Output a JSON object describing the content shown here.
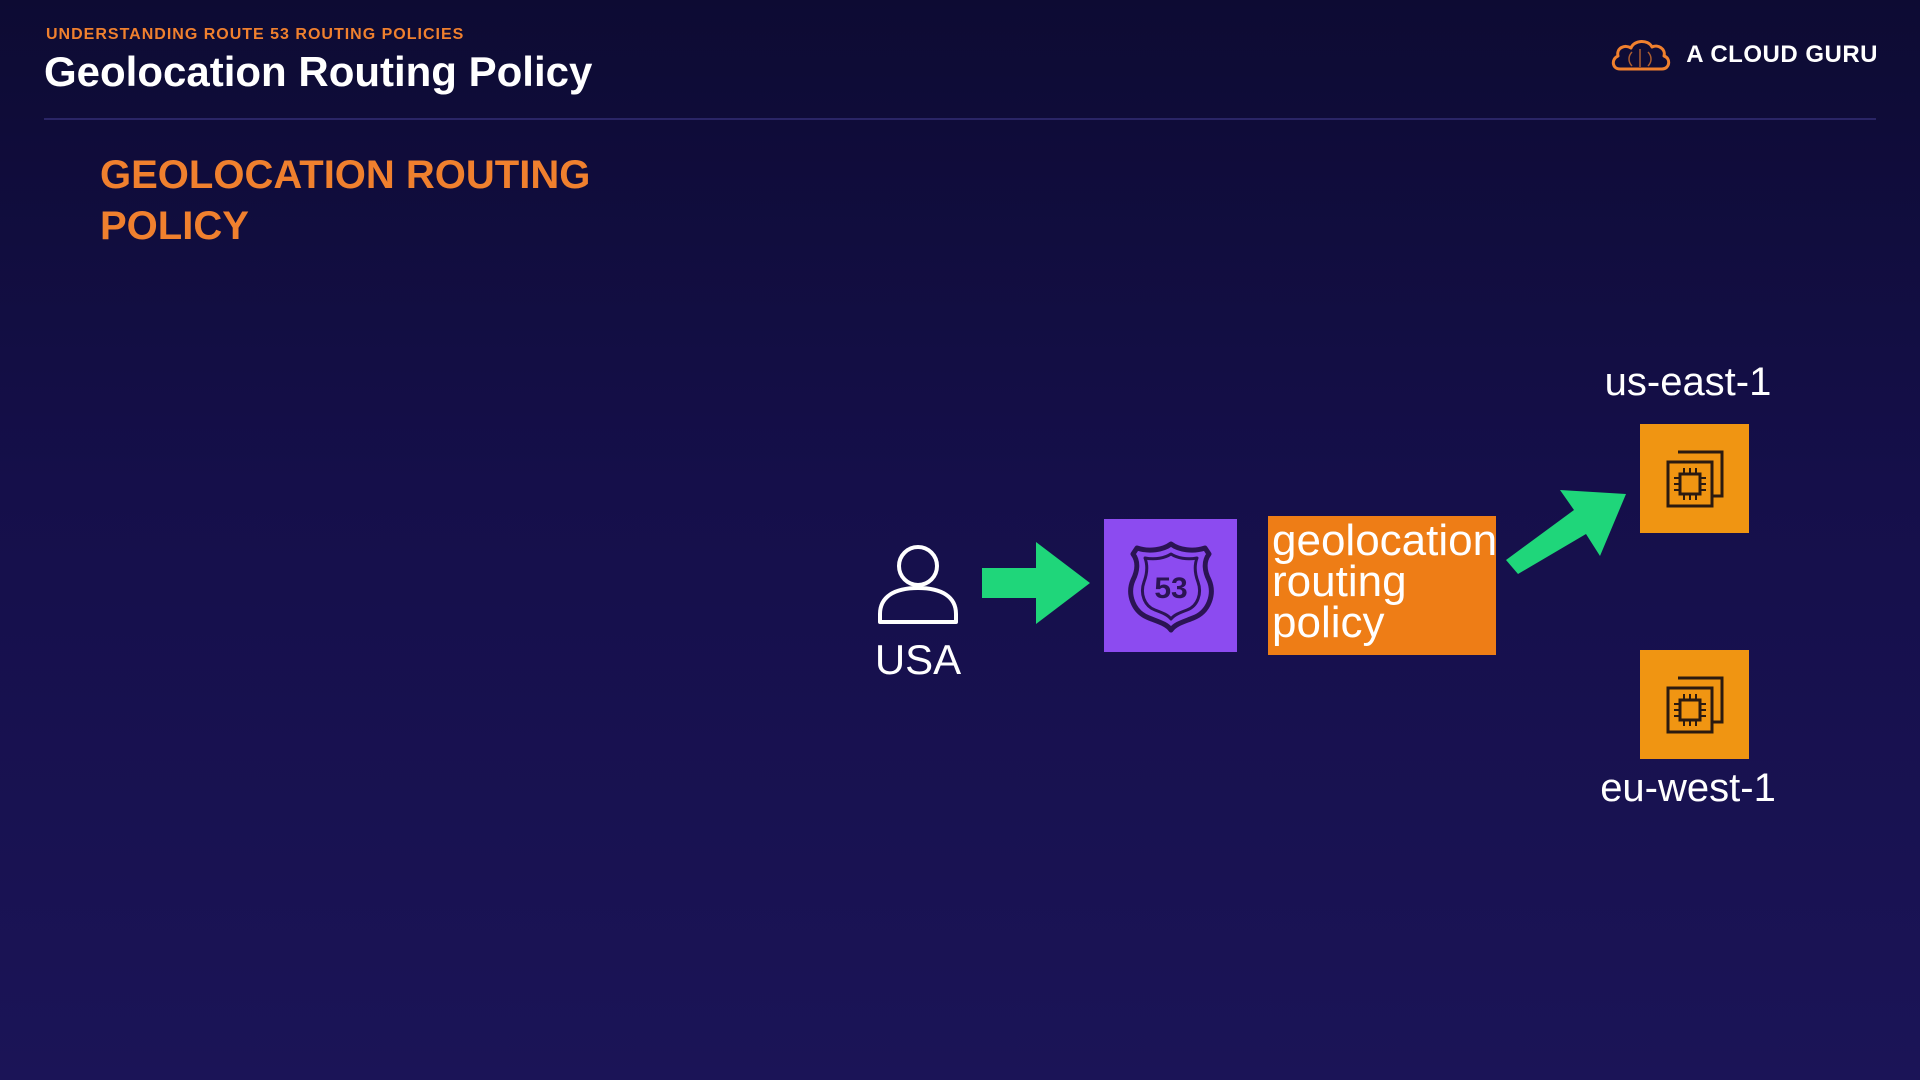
{
  "header": {
    "subtitle": "UNDERSTANDING ROUTE 53 ROUTING POLICIES",
    "title": "Geolocation Routing Policy",
    "brand": "A CLOUD GURU"
  },
  "section": {
    "title": "GEOLOCATION ROUTING POLICY"
  },
  "diagram": {
    "user_label": "USA",
    "route53_badge": "53",
    "policy_lines": [
      "geolocation",
      "routing",
      "policy"
    ],
    "regions": {
      "east": "us-east-1",
      "west": "eu-west-1"
    },
    "icons": {
      "user": "user-icon",
      "route53": "route53-shield-icon",
      "ec2": "ec2-instances-icon",
      "arrow": "arrow-icon",
      "logo": "cloud-logo-icon"
    }
  },
  "colors": {
    "background": "#150f4a",
    "accent_orange": "#f0802e",
    "route53_purple": "#8c4bf0",
    "policy_orange": "#ee7d16",
    "ec2_orange": "#f09512",
    "arrow_green": "#1fd67a"
  }
}
